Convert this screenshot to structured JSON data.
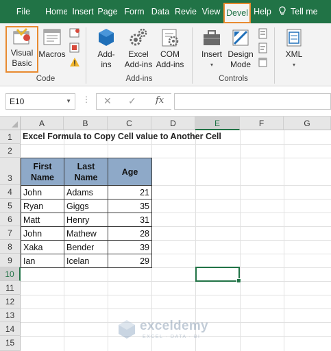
{
  "tabs": [
    "File",
    "Home",
    "Insert",
    "Page",
    "Form",
    "Data",
    "Revie",
    "View",
    "Devel",
    "Help",
    "Tell me"
  ],
  "ribbon": {
    "visual_basic": [
      "Visual",
      "Basic"
    ],
    "macros": "Macros",
    "addins": [
      "Add-",
      "ins"
    ],
    "excel_addins": [
      "Excel",
      "Add-ins"
    ],
    "com_addins": [
      "COM",
      "Add-ins"
    ],
    "insert": "Insert",
    "design_mode": [
      "Design",
      "Mode"
    ],
    "xml": "XML",
    "groups": {
      "code": "Code",
      "addins": "Add-ins",
      "controls": "Controls"
    }
  },
  "formula_bar": {
    "name_box": "E10",
    "formula": ""
  },
  "columns": [
    "A",
    "B",
    "C",
    "D",
    "E",
    "F",
    "G"
  ],
  "rows": [
    "1",
    "2",
    "3",
    "4",
    "5",
    "6",
    "7",
    "8",
    "9",
    "10",
    "11",
    "12",
    "13",
    "14",
    "15"
  ],
  "sheet": {
    "title": "Excel Formula to Copy Cell value to Another Cell",
    "headers": [
      "First Name",
      "Last Name",
      "Age"
    ],
    "data": [
      [
        "John",
        "Adams",
        "21"
      ],
      [
        "Ryan",
        "Giggs",
        "35"
      ],
      [
        "Matt",
        "Henry",
        "31"
      ],
      [
        "John",
        "Mathew",
        "28"
      ],
      [
        "Xaka",
        "Bender",
        "39"
      ],
      [
        "Ian",
        "Icelan",
        "29"
      ]
    ]
  },
  "watermark": {
    "name": "exceldemy",
    "tagline": "EXCEL · DATA · BI"
  },
  "colors": {
    "excel_green": "#217346",
    "highlight": "#e88a2f",
    "header_fill": "#8ea9c8"
  }
}
